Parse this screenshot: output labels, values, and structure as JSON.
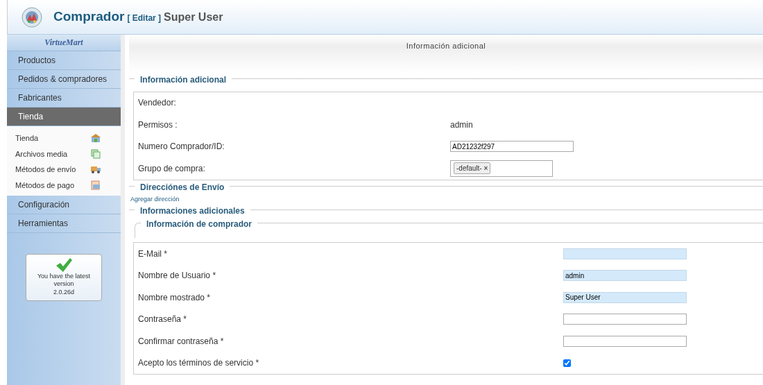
{
  "header": {
    "title": "Comprador",
    "edit_link": "[ Editar ]",
    "subtitle": "Super User"
  },
  "sidebar": {
    "logo": "VirtueMart",
    "menu": [
      {
        "label": "Productos",
        "selected": false
      },
      {
        "label": "Pedidos & compradores",
        "selected": false
      },
      {
        "label": "Fabricantes",
        "selected": false
      },
      {
        "label": "Tienda",
        "selected": true,
        "children": [
          {
            "label": "Tienda",
            "kind": "shop"
          },
          {
            "label": "Archivos media",
            "kind": "media"
          },
          {
            "label": "Métodos de envío",
            "kind": "truck"
          },
          {
            "label": "Métodos de pago",
            "kind": "card"
          }
        ]
      },
      {
        "label": "Configuración",
        "selected": false
      },
      {
        "label": "Herramientas",
        "selected": false
      }
    ],
    "version_box": {
      "lines": [
        "You have the latest",
        "version",
        "2.0.26d"
      ]
    }
  },
  "panel_title": "Información adicional",
  "sections": [
    {
      "legend": "Información adicional",
      "fields": [
        {
          "label": "Vendedor:",
          "kind": "text"
        },
        {
          "label": "Permisos :",
          "kind": "text",
          "value": "admin"
        },
        {
          "label": "Numero Comprador/ID:",
          "kind": "input",
          "value": "AD21232f297",
          "highlighted": false
        },
        {
          "label": "Grupo de compra:",
          "kind": "tags",
          "tags": [
            {
              "text": "-default-",
              "remove": "×"
            }
          ]
        }
      ]
    },
    {
      "legend": "Direcciónes de Envío",
      "link": "Agregar dirección"
    },
    {
      "legend": "Informaciones adicionales",
      "sublegend": "Información de comprador",
      "fields": [
        {
          "label": "E-Mail *",
          "kind": "input",
          "highlighted": true
        },
        {
          "label": "Nombre de Usuario *",
          "kind": "input",
          "value": "admin",
          "highlighted": true
        },
        {
          "label": "Nombre mostrado *",
          "kind": "input",
          "value": "Super User",
          "highlighted": true
        },
        {
          "label": "Contraseña *",
          "kind": "input",
          "highlighted": false
        },
        {
          "label": "Confirmar contraseña *",
          "kind": "input",
          "highlighted": false
        },
        {
          "label": "Acepto los términos de servicio *",
          "kind": "checkbox",
          "checked": true
        }
      ]
    }
  ]
}
